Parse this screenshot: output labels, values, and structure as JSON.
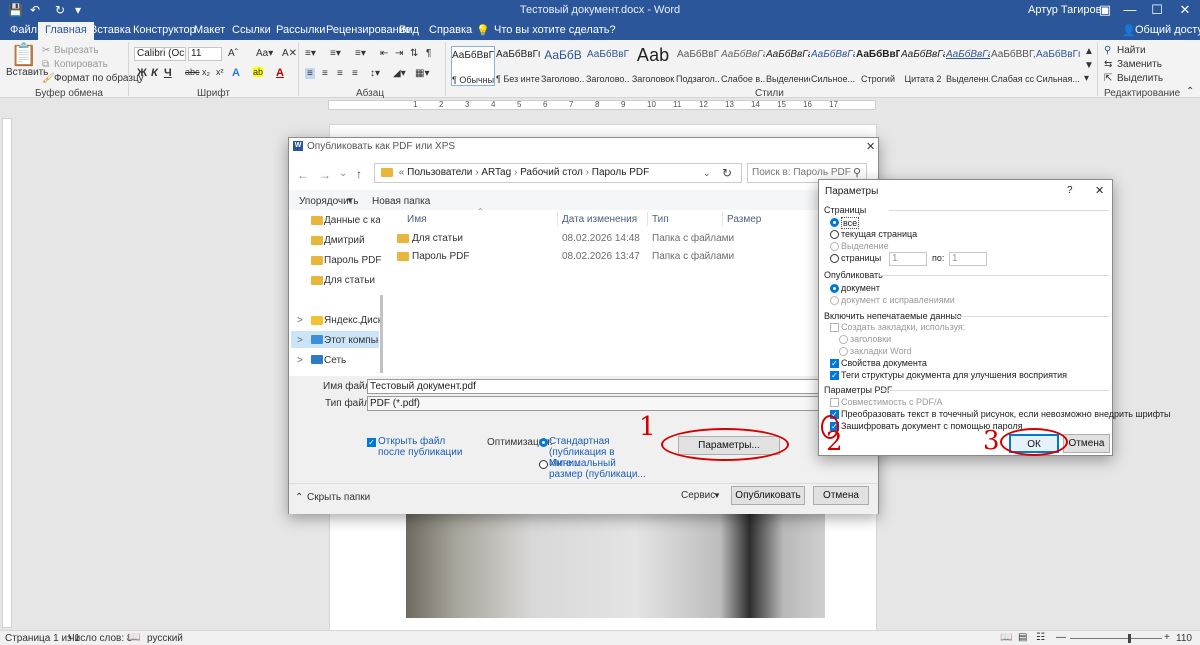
{
  "window": {
    "title": "Тестовый документ.docx  -  Word",
    "user": "Артур Тагиров"
  },
  "tabs": [
    "Файл",
    "Главная",
    "Вставка",
    "Конструктор",
    "Макет",
    "Ссылки",
    "Рассылки",
    "Рецензирование",
    "Вид",
    "Справка",
    "Что вы хотите сделать?"
  ],
  "share_label": "Общий доступ",
  "ribbon": {
    "clipboard": {
      "paste": "Вставить",
      "cut": "Вырезать",
      "copy": "Копировать",
      "format_painter": "Формат по образцу",
      "group": "Буфер обмена"
    },
    "font": {
      "name": "Calibri (Оснс",
      "size": "11",
      "group": "Шрифт"
    },
    "paragraph": {
      "group": "Абзац"
    },
    "styles": {
      "group": "Стили",
      "items": [
        {
          "sample": "АаБбВвГг,",
          "name": "¶ Обычный"
        },
        {
          "sample": "АаБбВвГг,",
          "name": "¶ Без инте..."
        },
        {
          "sample": "АаБбВ",
          "name": "Заголово..."
        },
        {
          "sample": "АаБбВвГ",
          "name": "Заголово..."
        },
        {
          "sample": "Ааb",
          "name": "Заголовок"
        },
        {
          "sample": "АаБбВвГ",
          "name": "Подзагол..."
        },
        {
          "sample": "АаБбВвГг",
          "name": "Слабое в..."
        },
        {
          "sample": "АаБбВвГг",
          "name": "Выделение"
        },
        {
          "sample": "АаБбВвГг",
          "name": "Сильное..."
        },
        {
          "sample": "АаБбВвГг",
          "name": "Строгий"
        },
        {
          "sample": "АаБбВвГг",
          "name": "Цитата 2"
        },
        {
          "sample": "АаБбВвГг",
          "name": "Выделенн..."
        },
        {
          "sample": "АаБбВВГ,",
          "name": "Слабая сс..."
        },
        {
          "sample": "АаБбВвГг,",
          "name": "Сильная..."
        }
      ]
    },
    "editing": {
      "find": "Найти",
      "replace": "Заменить",
      "select": "Выделить",
      "group": "Редактирование"
    }
  },
  "ruler_marks": [
    "1",
    "2",
    "3",
    "4",
    "5",
    "6",
    "7",
    "8",
    "9",
    "10",
    "11",
    "12",
    "13",
    "14",
    "15",
    "16",
    "17"
  ],
  "save_dialog": {
    "title": "Опубликовать как PDF или XPS",
    "path": [
      "Пользователи",
      "ARTag",
      "Рабочий стол",
      "Пароль PDF"
    ],
    "search_placeholder": "Поиск в: Пароль PDF",
    "organize": "Упорядочить",
    "new_folder": "Новая папка",
    "columns": [
      "Имя",
      "Дата изменения",
      "Тип",
      "Размер"
    ],
    "files": [
      {
        "name": "Для статьи",
        "date": "08.02.2026 14:48",
        "type": "Папка с файлами"
      },
      {
        "name": "Пароль PDF",
        "date": "08.02.2026 13:47",
        "type": "Папка с файлами"
      }
    ],
    "nav": [
      "Данные с карты",
      "Дмитрий",
      "Пароль PDF",
      "Для статьи",
      "Яндекс.Диск",
      "Этот компьюте",
      "Сеть"
    ],
    "filename_label": "Имя файла:",
    "filename": "Тестовый документ.pdf",
    "filetype_label": "Тип файла:",
    "filetype": "PDF (*.pdf)",
    "open_after": "Открыть файл после публикации",
    "optimize_label": "Оптимизация:",
    "opt_standard": "Стандартная (публикация в Инте...",
    "opt_min": "Минимальный размер (публикаци...",
    "options_button": "Параметры...",
    "hide_folders": "Скрыть папки",
    "tools": "Сервис",
    "publish": "Опубликовать",
    "cancel": "Отмена"
  },
  "params_dialog": {
    "title": "Параметры",
    "help": "?",
    "pages_section": "Страницы",
    "all": "все",
    "current": "текущая страница",
    "selection": "Выделение",
    "pages": "страницы",
    "from": "с:",
    "from_val": "1",
    "to": "по:",
    "to_val": "1",
    "publish_section": "Опубликовать",
    "document": "документ",
    "doc_markup": "документ с исправлениями",
    "nonprint_section": "Включить непечатаемые данные",
    "bookmarks": "Создать закладки, используя:",
    "headings": "заголовки",
    "word_bookmarks": "закладки Word",
    "doc_props": "Свойства документа",
    "struct_tags": "Теги структуры документа для улучшения восприятия",
    "pdf_section": "Параметры PDF",
    "pdfa": "Совместимость с PDF/A",
    "bitmap": "Преобразовать текст в точечный рисунок, если невозможно внедрить шрифты",
    "encrypt": "Зашифровать документ с помощью пароля",
    "ok": "ОК",
    "cancel": "Отмена"
  },
  "annotations": [
    "1",
    "2",
    "3"
  ],
  "status": {
    "page": "Страница 1 из 1",
    "words": "Число слов: 8",
    "lang": "русский",
    "zoom": "110 %"
  },
  "colors": {
    "word_blue": "#2b579a",
    "accent": "#0078d7",
    "annotation_red": "#d40000"
  }
}
